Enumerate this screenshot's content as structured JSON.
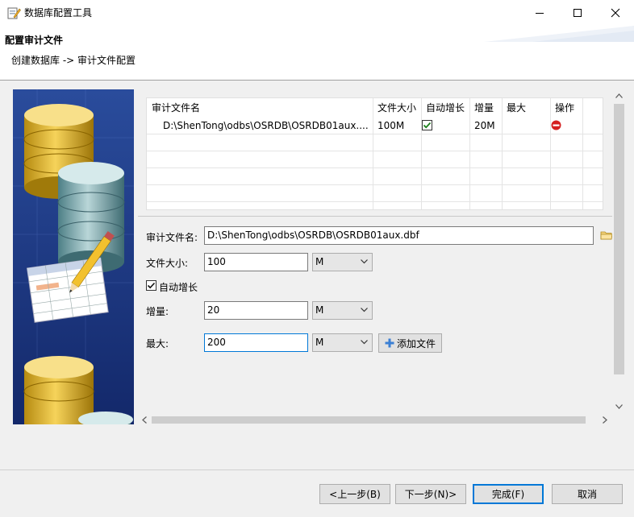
{
  "window": {
    "title": "数据库配置工具",
    "controls": [
      "minimize-icon",
      "maximize-icon",
      "close-icon"
    ]
  },
  "header": {
    "title": "配置审计文件",
    "breadcrumb": "创建数据库 -> 审计文件配置"
  },
  "table": {
    "columns": [
      "审计文件名",
      "文件大小",
      "自动增长",
      "增量",
      "最大",
      "操作"
    ],
    "rows": [
      {
        "file": "D:\\ShenTong\\odbs\\OSRDB\\OSRDB01aux....",
        "size": "100M",
        "auto_grow": true,
        "increment": "20M",
        "max": "",
        "action_icon": "delete-icon"
      }
    ]
  },
  "form": {
    "file_label": "审计文件名:",
    "file_value": "D:\\ShenTong\\odbs\\OSRDB\\OSRDB01aux.dbf",
    "size_label": "文件大小:",
    "size_value": "100",
    "size_unit": "M",
    "auto_grow_label": "自动增长",
    "auto_grow_checked": true,
    "inc_label": "增量:",
    "inc_value": "20",
    "inc_unit": "M",
    "max_label": "最大:",
    "max_value": "200",
    "max_unit": "M",
    "add_file_label": "添加文件"
  },
  "footer": {
    "prev": "<上一步(B)",
    "next": "下一步(N)>",
    "finish": "完成(F)",
    "cancel": "取消"
  },
  "colors": {
    "banner_bg": "#1f3c86",
    "focus_border": "#0078d7",
    "check_color": "#1a7f1a",
    "delete_color": "#d42020"
  }
}
